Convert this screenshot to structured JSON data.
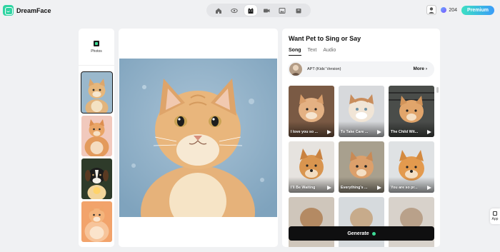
{
  "app": {
    "name": "DreamFace"
  },
  "nav": {
    "items": [
      {
        "name": "home",
        "icon": "home-icon"
      },
      {
        "name": "face",
        "icon": "eye-icon"
      },
      {
        "name": "pet",
        "icon": "cat-icon",
        "active": true
      },
      {
        "name": "video",
        "icon": "video-icon"
      },
      {
        "name": "image",
        "icon": "image-icon"
      },
      {
        "name": "tools",
        "icon": "box-icon"
      }
    ]
  },
  "header": {
    "credits": "204",
    "premium_label": "Premium"
  },
  "sidebar": {
    "photos_label": "Photos"
  },
  "panel": {
    "title": "Want Pet to Sing or Say",
    "tabs": [
      "Song",
      "Text",
      "Audio"
    ],
    "selected_song": "APT (Kids' Version)",
    "more_label": "More",
    "songs": [
      "I love you so ...",
      "To Take Care ...",
      "The Child Wit...",
      "I'll Be Waiting",
      "Everything's ...",
      "You are so pr..."
    ],
    "generate_label": "Generate"
  },
  "float": {
    "app_label": "App"
  },
  "colors": {
    "brand": "#2fd4a2",
    "premium_start": "#3ce0c3",
    "premium_end": "#3a9bf8",
    "generate_bg": "#0f0f10"
  }
}
